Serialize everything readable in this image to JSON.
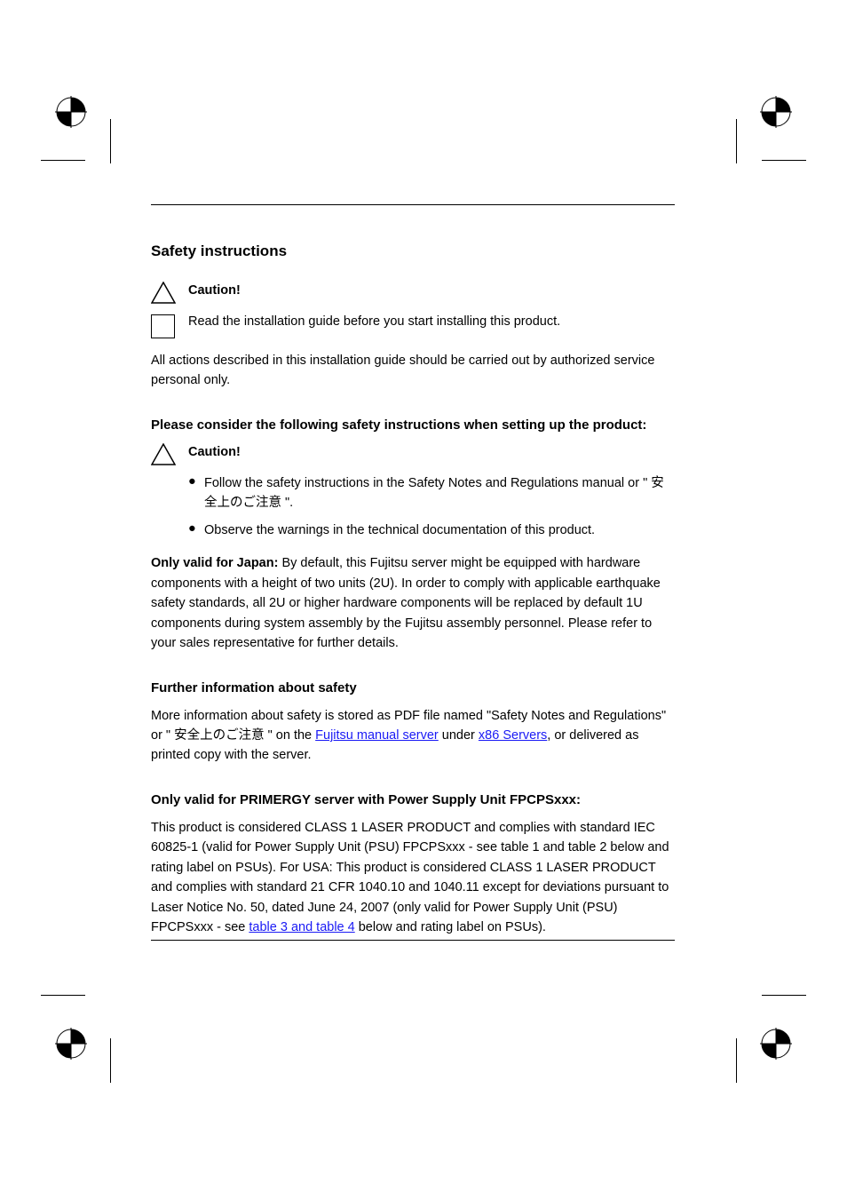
{
  "title": "Safety instructions",
  "caution1": {
    "label": "Caution!",
    "text": "Read the installation guide before you start installing this product."
  },
  "para1": "All actions described in this installation guide should be carried out by authorized service personal only.",
  "safety_instructions_heading": "Please consider the following safety instructions when setting up the product:",
  "caution2": "Caution!",
  "bullets": [
    "Follow the safety instructions in the Safety Notes and Regulations manual or \" 安全上のご注意 \".",
    "Observe the warnings in the technical documentation of this product."
  ],
  "para2_pre": "Only valid for Japan:",
  "para2_rest": "By default, this Fujitsu server might be equipped with hardware components with a height of two units (2U). In order to comply with applicable earthquake safety standards, all 2U or higher hardware components will be replaced by default 1U components during system assembly by the Fujitsu assembly personnel. Please refer to your sales representative for further details.",
  "further_heading": "Further information about safety",
  "para3_pre": "More information about safety is stored as PDF file named \"Safety Notes and Regulations\" or \" 安全上のご注意 \" on the ",
  "link1_text": "Fujitsu manual server",
  "para3_mid": " under ",
  "link2_text": "x86 Servers",
  "para3_end": ", or delivered as printed copy with the server.",
  "psu_heading": "Only valid for PRIMERGY server with Power Supply Unit FPCPSxxx:",
  "psu_para_pre": "This product is considered CLASS 1 LASER PRODUCT and complies with standard IEC 60825-1 (valid for Power Supply Unit (PSU) FPCPSxxx - see table 1 and table 2 below and rating label on PSUs). For USA: This product is considered CLASS 1 LASER PRODUCT and complies with standard 21 CFR 1040.10 and 1040.11 except for deviations pursuant to Laser Notice No. 50, dated June 24, 2007 (only valid for Power Supply Unit (PSU) FPCPSxxx - see ",
  "psu_link_text": "table 3 and table 4",
  "psu_para_end": " below and rating label on PSUs)."
}
